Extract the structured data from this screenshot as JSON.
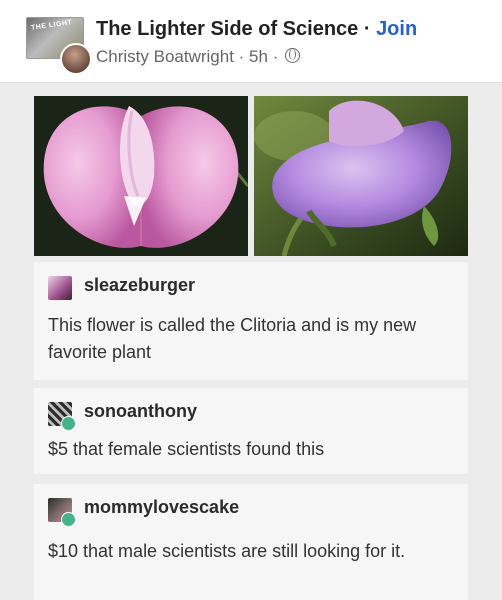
{
  "header": {
    "group_name": "The Lighter Side of Science",
    "separator": " · ",
    "join_label": "Join",
    "author": "Christy Boatwright",
    "time": "5h",
    "dot": " · ",
    "group_logo_text": "THE LIGHT"
  },
  "posts": [
    {
      "username": "sleazeburger",
      "text": "This flower is called the Clitoria and is my new favorite plant"
    },
    {
      "username": "sonoanthony",
      "text": "$5 that female scientists found this"
    },
    {
      "username": "mommylovescake",
      "text": "$10 that male scientists are still looking for it."
    }
  ],
  "colors": {
    "join": "#2a63c4",
    "flower_pink": "#e9a7d6",
    "flower_purple": "#b589d8",
    "badge": "#46b28a"
  }
}
